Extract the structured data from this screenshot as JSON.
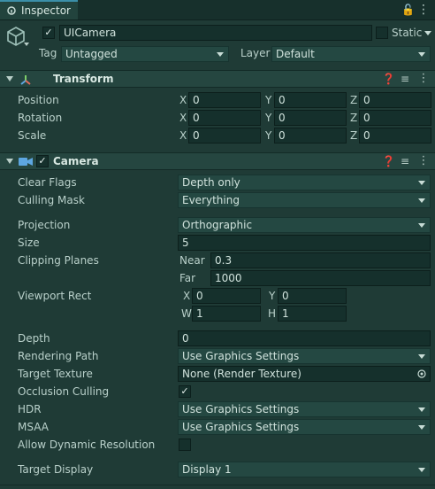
{
  "tab": {
    "label": "Inspector"
  },
  "object": {
    "name": "UICamera",
    "static_label": "Static",
    "tag_label": "Tag",
    "tag_value": "Untagged",
    "layer_label": "Layer",
    "layer_value": "Default"
  },
  "transform": {
    "title": "Transform",
    "rows": [
      {
        "label": "Position",
        "x": "0",
        "y": "0",
        "z": "0"
      },
      {
        "label": "Rotation",
        "x": "0",
        "y": "0",
        "z": "0"
      },
      {
        "label": "Scale",
        "x": "0",
        "y": "0",
        "z": "0"
      }
    ],
    "axes": {
      "x": "X",
      "y": "Y",
      "z": "Z"
    }
  },
  "camera": {
    "title": "Camera",
    "clear_flags": {
      "label": "Clear Flags",
      "value": "Depth only"
    },
    "culling_mask": {
      "label": "Culling Mask",
      "value": "Everything"
    },
    "projection": {
      "label": "Projection",
      "value": "Orthographic"
    },
    "size": {
      "label": "Size",
      "value": "5"
    },
    "clipping": {
      "label": "Clipping Planes",
      "near_label": "Near",
      "near": "0.3",
      "far_label": "Far",
      "far": "1000"
    },
    "viewport": {
      "label": "Viewport Rect",
      "x_label": "X",
      "x": "0",
      "y_label": "Y",
      "y": "0",
      "w_label": "W",
      "w": "1",
      "h_label": "H",
      "h": "1"
    },
    "depth": {
      "label": "Depth",
      "value": "0"
    },
    "rendering_path": {
      "label": "Rendering Path",
      "value": "Use Graphics Settings"
    },
    "target_texture": {
      "label": "Target Texture",
      "value": "None (Render Texture)"
    },
    "occlusion": {
      "label": "Occlusion Culling"
    },
    "hdr": {
      "label": "HDR",
      "value": "Use Graphics Settings"
    },
    "msaa": {
      "label": "MSAA",
      "value": "Use Graphics Settings"
    },
    "dynamic_res": {
      "label": "Allow Dynamic Resolution"
    },
    "target_display": {
      "label": "Target Display",
      "value": "Display 1"
    }
  },
  "icons": [
    "inspector-icon",
    "lock-icon",
    "menu-icon",
    "cube-icon",
    "help-icon",
    "settings-icon",
    "more-icon",
    "transform-icon",
    "camera-icon",
    "target-icon"
  ]
}
